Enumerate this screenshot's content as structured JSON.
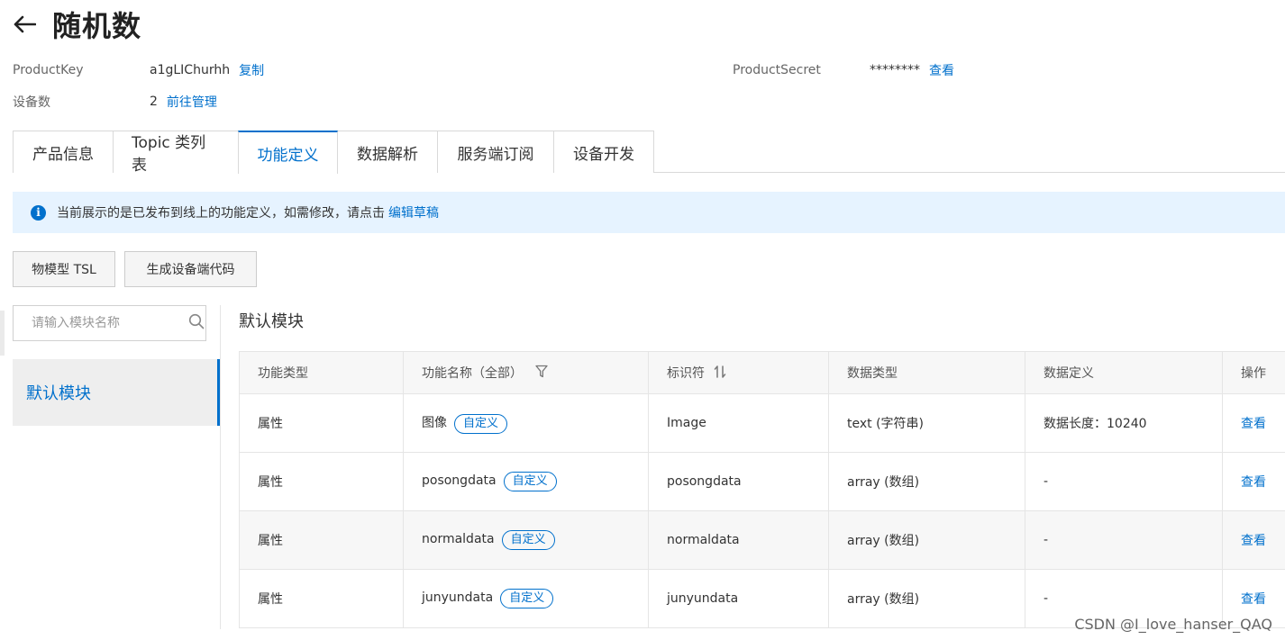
{
  "header": {
    "title": "随机数"
  },
  "info": {
    "product_key_label": "ProductKey",
    "product_key_value": "a1gLIChurhh",
    "copy_label": "复制",
    "product_secret_label": "ProductSecret",
    "product_secret_value": "********",
    "view_label": "查看",
    "device_count_label": "设备数",
    "device_count_value": "2",
    "manage_label": "前往管理"
  },
  "tabs": [
    {
      "label": "产品信息"
    },
    {
      "label": "Topic 类列表"
    },
    {
      "label": "功能定义",
      "active": true
    },
    {
      "label": "数据解析"
    },
    {
      "label": "服务端订阅"
    },
    {
      "label": "设备开发"
    }
  ],
  "notice": {
    "text": "当前展示的是已发布到线上的功能定义，如需修改，请点击",
    "link": "编辑草稿"
  },
  "toolbar": {
    "tsl_label": "物模型 TSL",
    "gen_code_label": "生成设备端代码"
  },
  "sidebar": {
    "search_placeholder": "请输入模块名称",
    "module_label": "默认模块"
  },
  "main": {
    "section_title": "默认模块"
  },
  "table": {
    "headers": [
      "功能类型",
      "功能名称（全部）",
      "标识符",
      "数据类型",
      "数据定义",
      "操作"
    ],
    "rows": [
      {
        "type": "属性",
        "name": "图像",
        "tag": "自定义",
        "identifier": "Image",
        "data_type": "text (字符串)",
        "definition": "数据长度：10240",
        "action": "查看"
      },
      {
        "type": "属性",
        "name": "posongdata",
        "tag": "自定义",
        "identifier": "posongdata",
        "data_type": "array (数组)",
        "definition": "-",
        "action": "查看"
      },
      {
        "type": "属性",
        "name": "normaldata",
        "tag": "自定义",
        "identifier": "normaldata",
        "data_type": "array (数组)",
        "definition": "-",
        "action": "查看"
      },
      {
        "type": "属性",
        "name": "junyundata",
        "tag": "自定义",
        "identifier": "junyundata",
        "data_type": "array (数组)",
        "definition": "-",
        "action": "查看"
      }
    ]
  },
  "watermark": "CSDN @I_love_hanser_QAQ",
  "colors": {
    "accent": "#0070cc",
    "notice_bg": "#e6f3ff"
  }
}
